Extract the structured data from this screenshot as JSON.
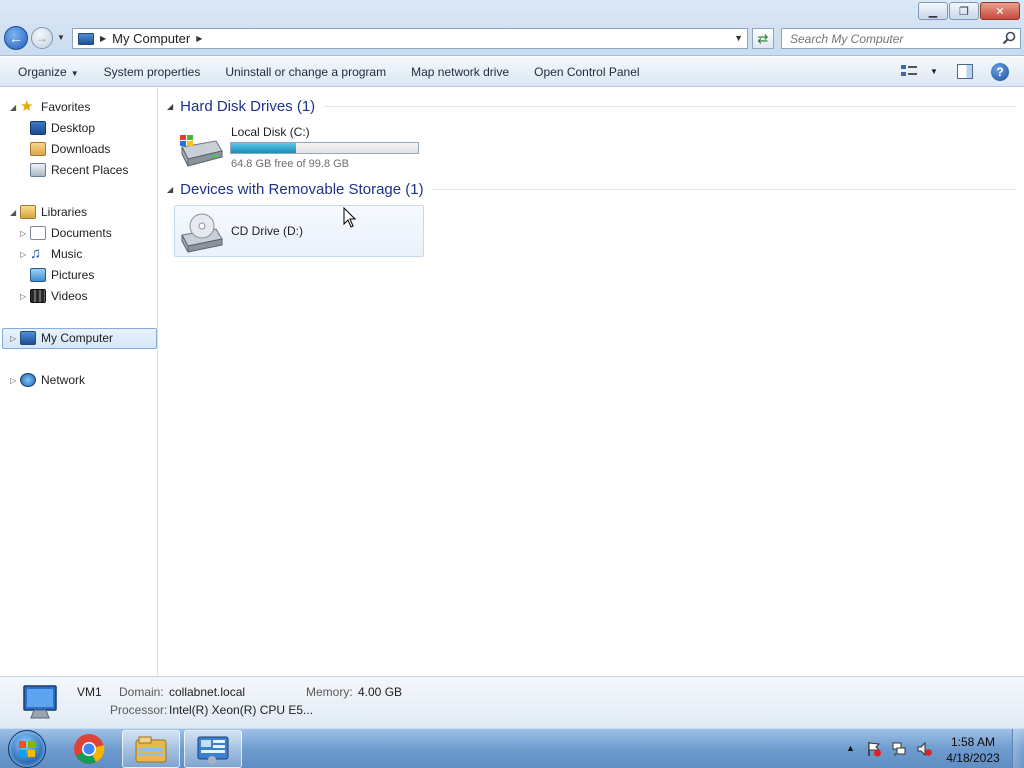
{
  "window": {
    "caption_buttons": {
      "minimize": "▁",
      "restore": "❐",
      "close": "✕"
    }
  },
  "address": {
    "path": "My Computer",
    "search_placeholder": "Search My Computer"
  },
  "toolbar": {
    "organize": "Organize",
    "items": [
      "System properties",
      "Uninstall or change a program",
      "Map network drive",
      "Open Control Panel"
    ]
  },
  "nav": {
    "favorites": "Favorites",
    "desktop": "Desktop",
    "downloads": "Downloads",
    "recent": "Recent Places",
    "libraries": "Libraries",
    "documents": "Documents",
    "music": "Music",
    "pictures": "Pictures",
    "videos": "Videos",
    "computer": "My Computer",
    "network": "Network"
  },
  "content": {
    "hdd_group": "Hard Disk Drives (1)",
    "removable_group": "Devices with Removable Storage (1)",
    "drive_c": {
      "name": "Local Disk (C:)",
      "free_text": "64.8 GB free of 99.8 GB",
      "used_fraction": 0.35
    },
    "drive_d": {
      "name": "CD Drive (D:)"
    }
  },
  "details": {
    "name": "VM1",
    "domain_label": "Domain:",
    "domain": "collabnet.local",
    "memory_label": "Memory:",
    "memory": "4.00 GB",
    "processor_label": "Processor:",
    "processor": "Intel(R) Xeon(R) CPU E5..."
  },
  "taskbar": {
    "time": "1:58 AM",
    "date": "4/18/2023"
  },
  "colors": {
    "group_title": "#1e3287",
    "disk_fill": "#1c8bb8",
    "selection": "#d4e6f7"
  }
}
